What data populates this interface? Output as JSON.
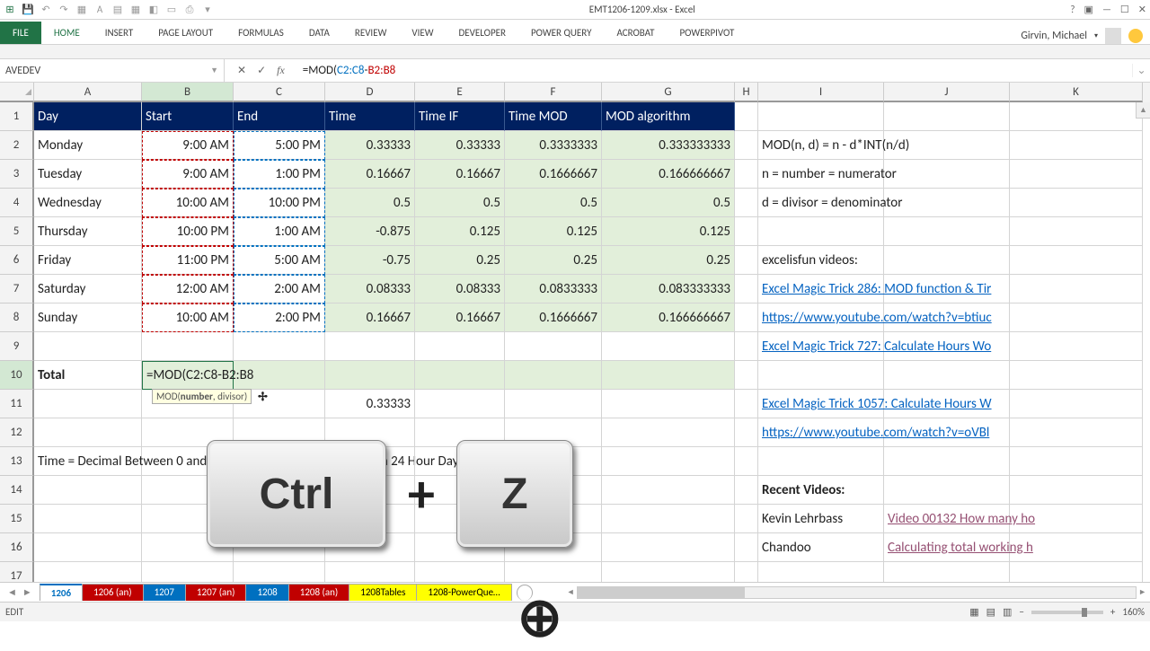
{
  "title": "EMT1206-1209.xlsx - Excel",
  "user": "Girvin, Michael",
  "ribbon": {
    "file": "FILE",
    "tabs": [
      "HOME",
      "INSERT",
      "PAGE LAYOUT",
      "FORMULAS",
      "DATA",
      "REVIEW",
      "VIEW",
      "DEVELOPER",
      "POWER QUERY",
      "ACROBAT",
      "POWERPIVOT"
    ]
  },
  "name_box": "AVEDEV",
  "formula_prefix": "=MOD(",
  "formula_ref1": "C2:C8",
  "formula_mid": "-",
  "formula_ref2": "B2:B8",
  "tooltip_fn": "MOD(",
  "tooltip_bold": "number",
  "tooltip_rest": ", divisor)",
  "columns": [
    "A",
    "B",
    "C",
    "D",
    "E",
    "F",
    "G",
    "H",
    "I",
    "J",
    "K"
  ],
  "headers": [
    "Day",
    "Start",
    "End",
    "Time",
    "Time IF",
    "Time MOD",
    "MOD algorithm"
  ],
  "rows": [
    {
      "r": 2,
      "day": "Monday",
      "start": "9:00 AM",
      "end": "5:00 PM",
      "t": "0.33333",
      "tif": "0.33333",
      "tmod": "0.3333333",
      "alg": "0.333333333"
    },
    {
      "r": 3,
      "day": "Tuesday",
      "start": "9:00 AM",
      "end": "1:00 PM",
      "t": "0.16667",
      "tif": "0.16667",
      "tmod": "0.1666667",
      "alg": "0.166666667"
    },
    {
      "r": 4,
      "day": "Wednesday",
      "start": "10:00 AM",
      "end": "10:00 PM",
      "t": "0.5",
      "tif": "0.5",
      "tmod": "0.5",
      "alg": "0.5"
    },
    {
      "r": 5,
      "day": "Thursday",
      "start": "10:00 PM",
      "end": "1:00 AM",
      "t": "-0.875",
      "tif": "0.125",
      "tmod": "0.125",
      "alg": "0.125"
    },
    {
      "r": 6,
      "day": "Friday",
      "start": "11:00 PM",
      "end": "5:00 AM",
      "t": "-0.75",
      "tif": "0.25",
      "tmod": "0.25",
      "alg": "0.25"
    },
    {
      "r": 7,
      "day": "Saturday",
      "start": "12:00 AM",
      "end": "2:00 AM",
      "t": "0.08333",
      "tif": "0.08333",
      "tmod": "0.0833333",
      "alg": "0.083333333"
    },
    {
      "r": 8,
      "day": "Sunday",
      "start": "10:00 AM",
      "end": "2:00 PM",
      "t": "0.16667",
      "tif": "0.16667",
      "tmod": "0.1666667",
      "alg": "0.166666667"
    }
  ],
  "side_text": {
    "i2": " MOD(n, d) = n - d*INT(n/d)",
    "i3": "n = number = numerator",
    "i4": "d = divisor = denominator",
    "i6": "excelisfun videos:",
    "i7": "Excel Magic Trick 286: MOD function & Tir",
    "i8": "https://www.youtube.com/watch?v=btiuc",
    "i9": "Excel Magic Trick 727: Calculate Hours Wo",
    "i11": "Excel Magic Trick 1057: Calculate Hours W",
    "i12": "https://www.youtube.com/watch?v=oVBl",
    "i14": "Recent Videos:",
    "i15": "Kevin Lehrbass",
    "j15": "Video 00132 How many ho",
    "i16": "Chandoo",
    "j16": "Calculating total working h"
  },
  "row10": {
    "label": "Total",
    "formula_prefix": "=MOD(",
    "ref1": "C2:C8",
    "mid": "-",
    "ref2": "B2:B8"
  },
  "d11": "0.33333",
  "row13": "Time = Decimal Between 0 and 1  Represents the Proportion of a 24 Hour Day",
  "sheet_tabs": [
    {
      "name": "1206",
      "cls": "blue active"
    },
    {
      "name": "1206 (an)",
      "cls": "red"
    },
    {
      "name": "1207",
      "cls": "blue"
    },
    {
      "name": "1207 (an)",
      "cls": "red"
    },
    {
      "name": "1208",
      "cls": "blue"
    },
    {
      "name": "1208 (an)",
      "cls": "red"
    },
    {
      "name": "1208Tables",
      "cls": "yellow"
    },
    {
      "name": "1208-PowerQue…",
      "cls": "yellow"
    }
  ],
  "status": {
    "mode": "EDIT",
    "zoom": "160%"
  },
  "keys": {
    "ctrl": "Ctrl",
    "plus": "+",
    "z": "Z"
  }
}
